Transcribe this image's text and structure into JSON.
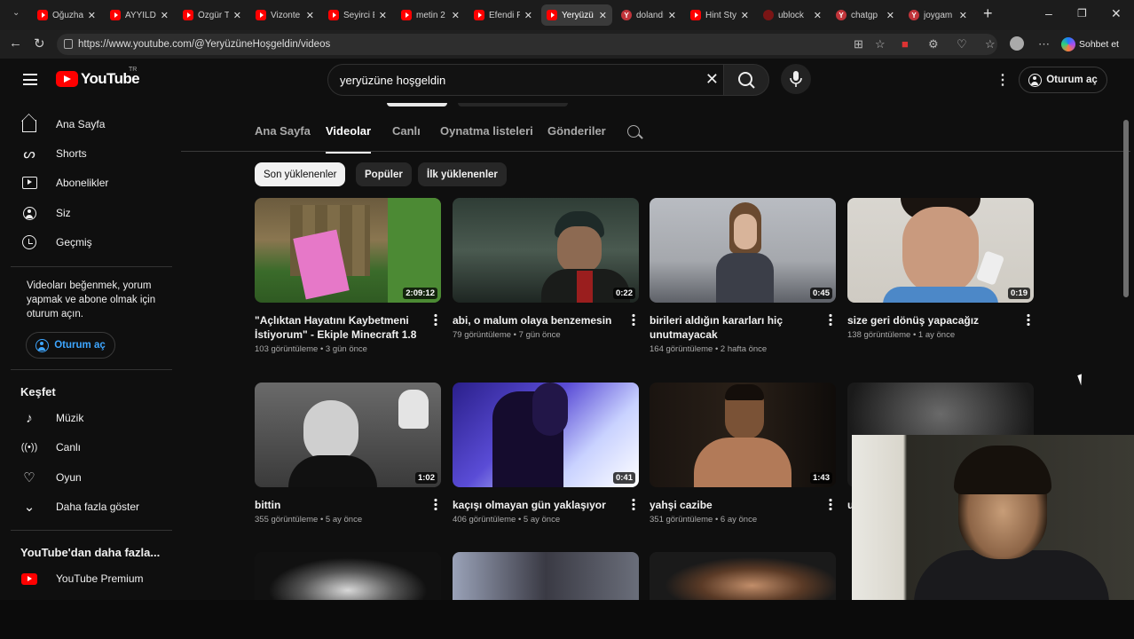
{
  "browser": {
    "tabs": [
      {
        "label": "Oğuzha",
        "icon": "youtube-favicon-icon"
      },
      {
        "label": "AYYILDI",
        "icon": "youtube-favicon-icon"
      },
      {
        "label": "Özgür T",
        "icon": "youtube-favicon-icon"
      },
      {
        "label": "Vizonte",
        "icon": "youtube-favicon-icon"
      },
      {
        "label": "Seyirci E",
        "icon": "youtube-favicon-icon"
      },
      {
        "label": "metin 2",
        "icon": "youtube-favicon-icon"
      },
      {
        "label": "Efendi F",
        "icon": "youtube-favicon-icon"
      },
      {
        "label": "Yeryüzü",
        "icon": "youtube-favicon-icon",
        "active": true
      },
      {
        "label": "dolandı",
        "icon": "yandex-favicon-icon"
      },
      {
        "label": "Hint Sty",
        "icon": "youtube-favicon-icon"
      },
      {
        "label": "ublock",
        "icon": "ublock-favicon-icon"
      },
      {
        "label": "chatgp",
        "icon": "yandex-favicon-icon"
      },
      {
        "label": "joygam",
        "icon": "yandex-favicon-icon"
      }
    ],
    "url": "https://www.youtube.com/@YeryüzüneHoşgeldin/videos",
    "copilot_label": "Sohbet et"
  },
  "masthead": {
    "logo_text": "YouTube",
    "country_code": "TR",
    "search_value": "yeryüzüne hoşgeldin",
    "signin_label": "Oturum aç"
  },
  "sidebar": {
    "items": [
      {
        "label": "Ana Sayfa",
        "icon": "home-icon"
      },
      {
        "label": "Shorts",
        "icon": "shorts-icon"
      },
      {
        "label": "Abonelikler",
        "icon": "subscriptions-icon"
      },
      {
        "label": "Siz",
        "icon": "you-icon"
      },
      {
        "label": "Geçmiş",
        "icon": "history-icon"
      }
    ],
    "signin_message": "Videoları beğenmek, yorum yapmak ve abone olmak için oturum açın.",
    "signin_label": "Oturum aç",
    "explore_title": "Keşfet",
    "explore_items": [
      {
        "label": "Müzik",
        "icon": "music-icon"
      },
      {
        "label": "Canlı",
        "icon": "live-icon"
      },
      {
        "label": "Oyun",
        "icon": "gaming-icon"
      },
      {
        "label": "Daha fazla göster",
        "icon": "chevron-down-icon"
      }
    ],
    "more_title": "YouTube'dan daha fazla...",
    "more_items": [
      {
        "label": "YouTube Premium",
        "icon": "youtube-premium-icon"
      }
    ]
  },
  "channel_tabs": [
    "Ana Sayfa",
    "Videolar",
    "Canlı",
    "Oynatma listeleri",
    "Gönderiler"
  ],
  "active_tab": "Videolar",
  "filters": [
    "Son yüklenenler",
    "Popüler",
    "İlk yüklenenler"
  ],
  "active_filter": "Son yüklenenler",
  "videos": [
    {
      "title": "\"Açlıktan Hayatını Kaybetmeni İstiyorum\" - Ekiple Minecraft 1.8",
      "views": "103 görüntüleme",
      "age": "3 gün önce",
      "duration": "2:09:12"
    },
    {
      "title": "abi, o malum olaya benzemesin",
      "views": "79 görüntüleme",
      "age": "7 gün önce",
      "duration": "0:22"
    },
    {
      "title": "birileri aldığın kararları hiç unutmayacak",
      "views": "164 görüntüleme",
      "age": "2 hafta önce",
      "duration": "0:45"
    },
    {
      "title": "size geri dönüş yapacağız",
      "views": "138 görüntüleme",
      "age": "1 ay önce",
      "duration": "0:19"
    },
    {
      "title": "bittin",
      "views": "355 görüntüleme",
      "age": "5 ay önce",
      "duration": "1:02"
    },
    {
      "title": "kaçışı olmayan gün yaklaşıyor",
      "views": "406 görüntüleme",
      "age": "5 ay önce",
      "duration": "0:41"
    },
    {
      "title": "yahşi cazibe",
      "views": "351 görüntüleme",
      "age": "6 ay önce",
      "duration": "1:43"
    },
    {
      "title": "u",
      "views": "",
      "age": "",
      "duration": ""
    }
  ],
  "colors": {
    "youtube_red": "#ff0000",
    "link_blue": "#3ea6ff",
    "background": "#0f0f0f"
  }
}
